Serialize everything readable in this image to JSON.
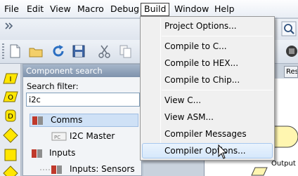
{
  "menubar": {
    "items": [
      "File",
      "Edit",
      "View",
      "Macro",
      "Debug",
      "Build",
      "Window",
      "Help"
    ],
    "active": "Build"
  },
  "build_menu": {
    "items": [
      "Project Options...",
      "Compile to C...",
      "Compile to HEX...",
      "Compile to Chip...",
      "View C...",
      "View ASM...",
      "Compiler Messages",
      "Compiler Options..."
    ],
    "hovered": "Compiler Options..."
  },
  "component_search": {
    "title": "Component search",
    "filter_label": "Search filter:",
    "filter_value": "i2c",
    "tree": [
      "Comms",
      "I2C Master",
      "Inputs",
      "Inputs: Sensors"
    ],
    "selected": "Comms"
  },
  "canvas": {
    "labels": [
      "Res",
      "Output"
    ]
  },
  "colors": {
    "menu_hover": "#d6e8fb",
    "panel_title": "#7e92ac",
    "tree_selected": "#cfe1f6"
  }
}
